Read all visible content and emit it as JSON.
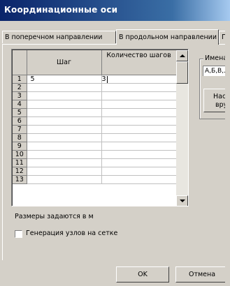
{
  "window": {
    "title": "Координационные оси"
  },
  "tabs": [
    {
      "label": "В поперечном направлении"
    },
    {
      "label": "В продольном направлении"
    },
    {
      "label": "П"
    }
  ],
  "grid": {
    "columns": [
      "Шаг",
      "Количество шагов"
    ],
    "rows": [
      {
        "num": "1",
        "step": "5",
        "count": "3"
      },
      {
        "num": "2",
        "step": "",
        "count": ""
      },
      {
        "num": "3",
        "step": "",
        "count": ""
      },
      {
        "num": "4",
        "step": "",
        "count": ""
      },
      {
        "num": "5",
        "step": "",
        "count": ""
      },
      {
        "num": "6",
        "step": "",
        "count": ""
      },
      {
        "num": "7",
        "step": "",
        "count": ""
      },
      {
        "num": "8",
        "step": "",
        "count": ""
      },
      {
        "num": "9",
        "step": "",
        "count": ""
      },
      {
        "num": "10",
        "step": "",
        "count": ""
      },
      {
        "num": "11",
        "step": "",
        "count": ""
      },
      {
        "num": "12",
        "step": "",
        "count": ""
      },
      {
        "num": "13",
        "step": "",
        "count": ""
      }
    ]
  },
  "names_group": {
    "label": "Имена",
    "field_value": "А,Б,В,...",
    "button_line1": "Наст",
    "button_line2": "вру"
  },
  "units_label": "Размеры задаются в  м",
  "grid_nodes_checkbox": {
    "label": "Генерация узлов на сетке",
    "checked": false
  },
  "buttons": {
    "ok": "OK",
    "cancel": "Отмена"
  }
}
